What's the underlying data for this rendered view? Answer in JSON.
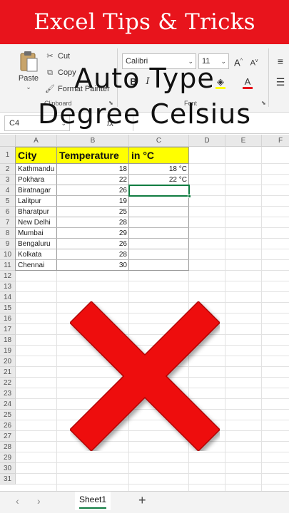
{
  "banner": {
    "title": "Excel Tips & Tricks"
  },
  "overlay": {
    "line1": "Auto Type",
    "line2": "Degree Celsius"
  },
  "ribbon": {
    "clipboard": {
      "paste_label": "Paste",
      "cut_label": "Cut",
      "copy_label": "Copy",
      "format_painter_label": "Format Painter",
      "group_label": "Clipboard"
    },
    "font": {
      "name": "Calibri",
      "size": "11",
      "group_label": "Font"
    }
  },
  "formula_bar": {
    "name_box": "C4",
    "fx_label": "fx",
    "value": ""
  },
  "sheet": {
    "columns": [
      "A",
      "B",
      "C",
      "D",
      "E",
      "F"
    ],
    "rows": [
      "1",
      "2",
      "3",
      "4",
      "5",
      "6",
      "7",
      "8",
      "9",
      "10",
      "11",
      "12",
      "13",
      "14",
      "15",
      "16",
      "17",
      "18",
      "19",
      "20",
      "21",
      "22",
      "23",
      "24",
      "25",
      "26",
      "27",
      "28",
      "29",
      "30",
      "31"
    ],
    "headers": {
      "city": "City",
      "temperature": "Temperature",
      "unit": "in °C"
    },
    "data": [
      {
        "city": "Kathmandu",
        "temp": "18",
        "unit": "18 °C"
      },
      {
        "city": "Pokhara",
        "temp": "22",
        "unit": "22 °C"
      },
      {
        "city": "Biratnagar",
        "temp": "26",
        "unit": ""
      },
      {
        "city": "Lalitpur",
        "temp": "19",
        "unit": ""
      },
      {
        "city": "Bharatpur",
        "temp": "25",
        "unit": ""
      },
      {
        "city": "New Delhi",
        "temp": "28",
        "unit": ""
      },
      {
        "city": "Mumbai",
        "temp": "29",
        "unit": ""
      },
      {
        "city": "Bengaluru",
        "temp": "26",
        "unit": ""
      },
      {
        "city": "Kolkata",
        "temp": "28",
        "unit": ""
      },
      {
        "city": "Chennai",
        "temp": "30",
        "unit": ""
      }
    ]
  },
  "tabs": {
    "sheet1": "Sheet1",
    "add": "+"
  },
  "colors": {
    "banner": "#e8141c",
    "header_fill": "#ffff00",
    "cross": "#ee1111",
    "selection": "#107c41"
  }
}
